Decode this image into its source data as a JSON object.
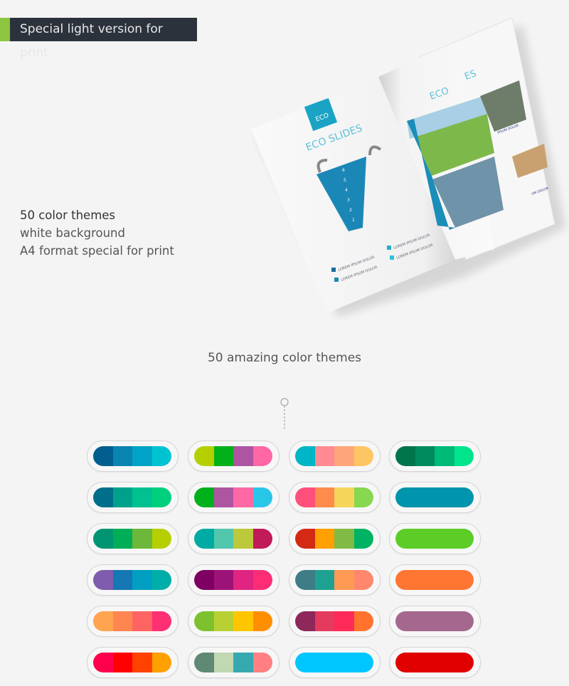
{
  "banner": {
    "label": "Special light version for print",
    "accent_color": "#8cc63f",
    "bg_color": "#2b323b"
  },
  "features": [
    "50 color themes",
    "white background",
    "A4 format special for print"
  ],
  "magazine": {
    "badge": "ECO",
    "left_title": "ECO SLIDES",
    "right_title_visible": [
      "ECO",
      "ES"
    ],
    "list_items": [
      "LOREM IPSUM DOLOR",
      "LOREM IPSUM DOLOR",
      "LOREM IPSUM DOLOR",
      "LOREM IPSUM DOLOR"
    ],
    "side_headings": [
      "IPSUM DOLOR",
      "UM DOLOR"
    ],
    "funnel_levels": [
      "6",
      "5",
      "4",
      "3",
      "2",
      "1"
    ],
    "accent_color": "#1aa3c4"
  },
  "subtitle": "50 amazing color themes",
  "palettes": [
    [
      "#005f8e",
      "#0a84b0",
      "#00a4c6",
      "#00c3d1"
    ],
    [
      "#b4d000",
      "#00b11a",
      "#ad55a1",
      "#ff67a5"
    ],
    [
      "#00b5c6",
      "#ff8a91",
      "#ffa57c",
      "#fec663"
    ],
    [
      "#00744b",
      "#008b5e",
      "#00ba78",
      "#00e58c"
    ],
    [
      "#006f8b",
      "#00a18c",
      "#00c18f",
      "#00d07e"
    ],
    [
      "#00b11c",
      "#ad55a1",
      "#ff67a5",
      "#29c7e7"
    ],
    [
      "#ff4f7b",
      "#ff8b4c",
      "#f6d55b",
      "#85d84f"
    ],
    [
      "#0094ad"
    ],
    [
      "#009570",
      "#00ae57",
      "#6db73a",
      "#b5cf00"
    ],
    [
      "#00aba3",
      "#53c7ae",
      "#bbc93a",
      "#c11b5a"
    ],
    [
      "#d42a14",
      "#ff9f00",
      "#81bb45",
      "#00b263"
    ],
    [
      "#5ccd27"
    ],
    [
      "#7f5cad",
      "#1577b4",
      "#009fc1",
      "#00aea9"
    ],
    [
      "#7d0062",
      "#9d1277",
      "#df2481",
      "#fc2d75"
    ],
    [
      "#3e7d85",
      "#1ea191",
      "#ff9a55",
      "#ff876e"
    ],
    [
      "#ff7532"
    ],
    [
      "#ffa550",
      "#ff8650",
      "#ff6463",
      "#ff2f73"
    ],
    [
      "#7ec12f",
      "#b8d034",
      "#ffc600",
      "#ff8f00"
    ],
    [
      "#8e285a",
      "#e43a5e",
      "#ff2a57",
      "#ff732f"
    ],
    [
      "#a4688f"
    ],
    [
      "#ff004d",
      "#ff0000",
      "#ff4200",
      "#ffa000"
    ],
    [
      "#5f8974",
      "#c1d8b3",
      "#36a9b0",
      "#ff7f82"
    ],
    [
      "#00c6ff"
    ],
    [
      "#e10000"
    ]
  ]
}
